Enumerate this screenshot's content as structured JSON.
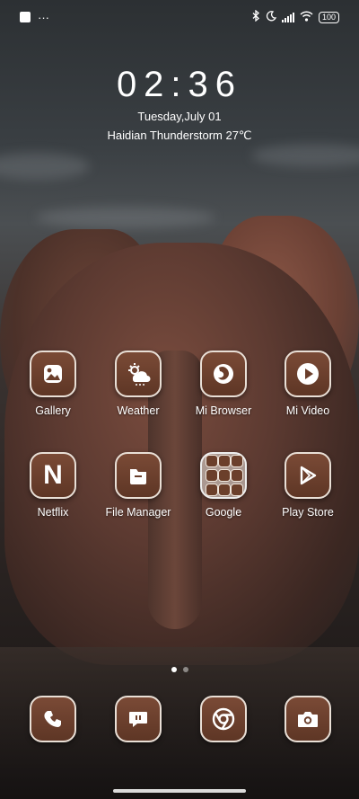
{
  "status_bar": {
    "more_indicator": "···",
    "battery": "100"
  },
  "lock_clock": {
    "time": "02:36",
    "date": "Tuesday,July 01",
    "weather": "Haidian Thunderstorm 27℃"
  },
  "home_apps": [
    {
      "label": "Gallery",
      "icon": "gallery-icon"
    },
    {
      "label": "Weather",
      "icon": "weather-icon"
    },
    {
      "label": "Mi Browser",
      "icon": "browser-icon"
    },
    {
      "label": "Mi Video",
      "icon": "play-icon"
    },
    {
      "label": "Netflix",
      "icon": "netflix-icon"
    },
    {
      "label": "File Manager",
      "icon": "folder-icon"
    },
    {
      "label": "Google",
      "icon": "google-folder-icon"
    },
    {
      "label": "Play Store",
      "icon": "play-store-icon"
    }
  ],
  "dock": [
    {
      "icon": "phone-icon"
    },
    {
      "icon": "messages-icon"
    },
    {
      "icon": "chrome-icon"
    },
    {
      "icon": "camera-icon"
    }
  ],
  "page_indicator": {
    "pages": 2,
    "current": 1
  }
}
